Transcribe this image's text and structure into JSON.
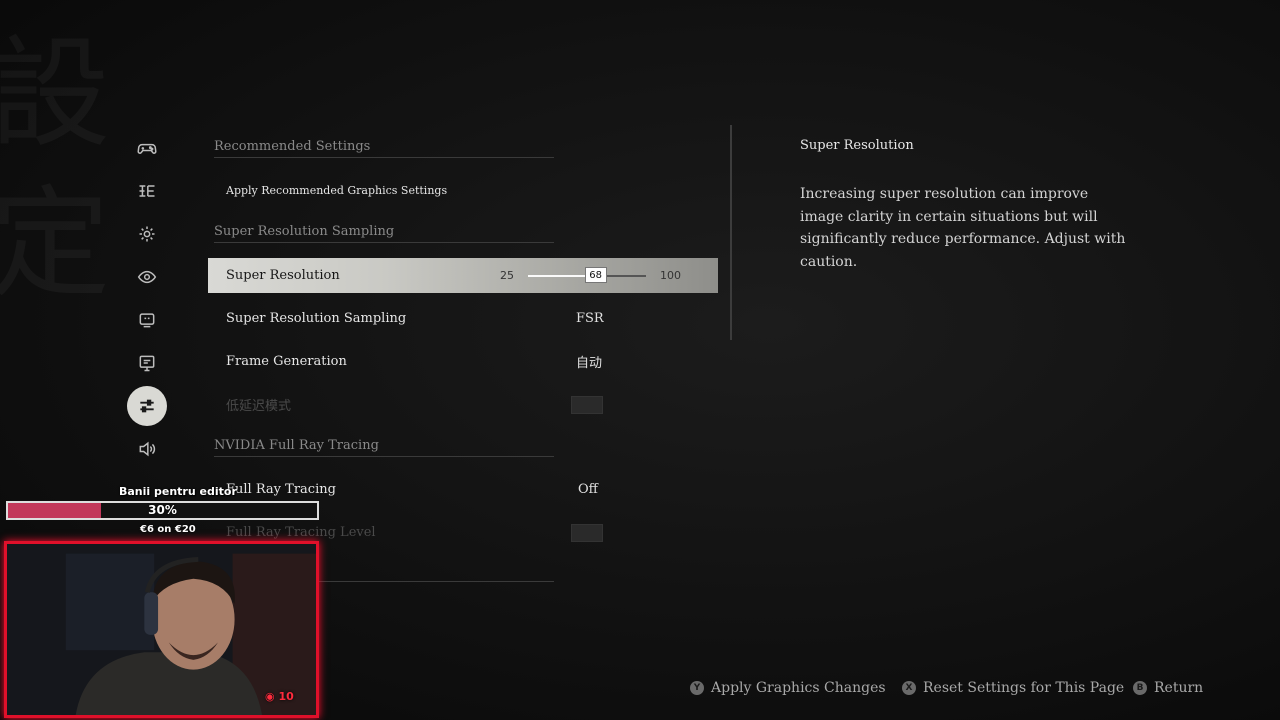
{
  "background_glyph": "設定",
  "rail": {
    "items": [
      {
        "name": "controller-icon"
      },
      {
        "name": "language-icon"
      },
      {
        "name": "gear-icon"
      },
      {
        "name": "eye-icon"
      },
      {
        "name": "display-icon"
      },
      {
        "name": "monitor-icon"
      },
      {
        "name": "sliders-icon",
        "active": true
      },
      {
        "name": "speaker-icon"
      }
    ]
  },
  "list": {
    "sections": {
      "recommended": "Recommended Settings",
      "sampling": "Super Resolution Sampling",
      "rtx": "NVIDIA Full Ray Tracing"
    },
    "rows": {
      "apply_recommended": "Apply Recommended Graphics Settings",
      "super_resolution": {
        "label": "Super Resolution",
        "min": "25",
        "max": "100",
        "value": "68",
        "fraction": 0.573
      },
      "sampling": {
        "label": "Super Resolution Sampling",
        "value": "FSR"
      },
      "frame_generation": {
        "label": "Frame Generation",
        "value": "自动"
      },
      "low_latency": {
        "label": "低延迟模式"
      },
      "full_ray_tracing": {
        "label": "Full Ray Tracing",
        "value": "Off"
      },
      "ray_tracing_level": {
        "label": "Full Ray Tracing Level"
      }
    }
  },
  "description": {
    "title": "Super Resolution",
    "body": "Increasing super resolution can improve image clarity in certain situations but will significantly reduce performance. Adjust with caution."
  },
  "footer": {
    "apply": {
      "glyph": "Y",
      "label": "Apply Graphics Changes"
    },
    "reset": {
      "glyph": "X",
      "label": "Reset Settings for This Page"
    },
    "return": {
      "glyph": "B",
      "label": "Return"
    }
  },
  "overlay": {
    "goal_title": "Banii pentru editor",
    "goal_percent": "30%",
    "goal_fraction": 0.3,
    "goal_amount": "€6 on €20",
    "viewers": "10"
  },
  "colors": {
    "selected_row": "#d9d9d5",
    "goal_fill": "#c2385a",
    "webcam_border": "#e0102a"
  }
}
